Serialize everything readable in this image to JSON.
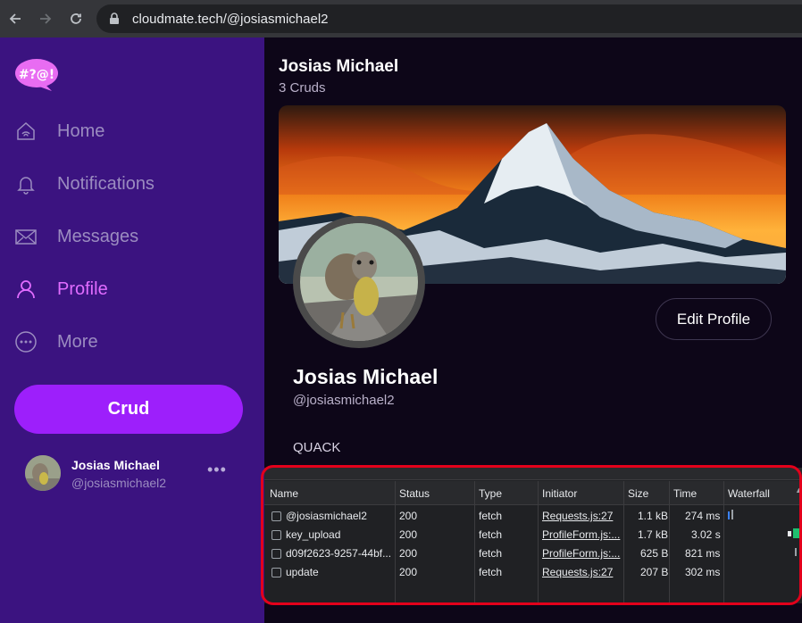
{
  "browser": {
    "url": "cloudmate.tech/@josiasmichael2"
  },
  "sidebar": {
    "logo_text": "#?@!",
    "items": [
      {
        "label": "Home",
        "icon": "home-icon"
      },
      {
        "label": "Notifications",
        "icon": "bell-icon"
      },
      {
        "label": "Messages",
        "icon": "envelope-icon"
      },
      {
        "label": "Profile",
        "icon": "user-icon",
        "active": true
      },
      {
        "label": "More",
        "icon": "more-circle-icon"
      }
    ],
    "crud_label": "Crud",
    "account": {
      "name": "Josias Michael",
      "handle": "@josiasmichael2",
      "menu": "•••"
    }
  },
  "profile": {
    "header_name": "Josias Michael",
    "crud_count": "3 Cruds",
    "edit_label": "Edit Profile",
    "name": "Josias Michael",
    "handle": "@josiasmichael2",
    "bio": "QUACK"
  },
  "network": {
    "columns": [
      "Name",
      "Status",
      "Type",
      "Initiator",
      "Size",
      "Time",
      "Waterfall"
    ],
    "rows": [
      {
        "name": "@josiasmichael2",
        "status": "200",
        "type": "fetch",
        "initiator": "Requests.js:27",
        "size": "1.1 kB",
        "time": "274 ms"
      },
      {
        "name": "key_upload",
        "status": "200",
        "type": "fetch",
        "initiator": "ProfileForm.js:...",
        "size": "1.7 kB",
        "time": "3.02 s"
      },
      {
        "name": "d09f2623-9257-44bf...",
        "status": "200",
        "type": "fetch",
        "initiator": "ProfileForm.js:...",
        "size": "625 B",
        "time": "821 ms"
      },
      {
        "name": "update",
        "status": "200",
        "type": "fetch",
        "initiator": "Requests.js:27",
        "size": "207 B",
        "time": "302 ms"
      }
    ]
  },
  "colors": {
    "sidebar_bg": "#3b1380",
    "accent": "#9d1ffb",
    "active_nav": "#e16cff",
    "highlight_border": "#e3001b"
  }
}
